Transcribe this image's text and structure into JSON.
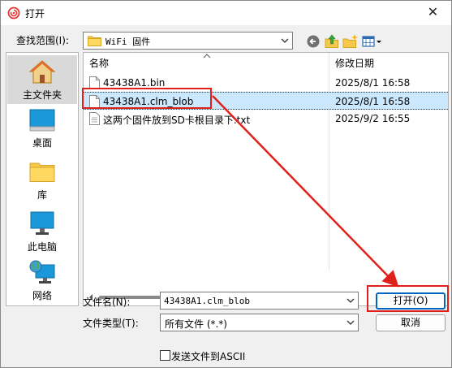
{
  "dialog": {
    "title": "打开",
    "close_glyph": "✕"
  },
  "toolbar": {
    "lookin_label": "查找范围(I):",
    "lookin_value": "WiFi 固件",
    "icons": [
      "back-icon",
      "up-folder-icon",
      "new-folder-icon",
      "view-menu-icon"
    ]
  },
  "places": [
    {
      "label": "主文件夹",
      "icon": "home-icon",
      "selected": true
    },
    {
      "label": "桌面",
      "icon": "desktop-icon"
    },
    {
      "label": "库",
      "icon": "library-icon"
    },
    {
      "label": "此电脑",
      "icon": "computer-icon"
    },
    {
      "label": "网络",
      "icon": "network-icon"
    }
  ],
  "filelist": {
    "columns": [
      "名称",
      "修改日期"
    ],
    "files": [
      {
        "name": "43438A1.bin",
        "modified": "2025/8/1 16:58"
      },
      {
        "name": "43438A1.clm_blob",
        "modified": "2025/8/1 16:58",
        "selected": true
      },
      {
        "name": "这两个固件放到SD卡根目录下.txt",
        "modified": "2025/9/2 16:55"
      }
    ]
  },
  "form": {
    "filename_label": "文件名(N):",
    "filename_value": "43438A1.clm_blob",
    "filetype_label": "文件类型(T):",
    "filetype_value": "所有文件 (*.*)",
    "open_label": "打开(O)",
    "cancel_label": "取消",
    "ascii_label": "发送文件到ASCII",
    "ascii_checked": false
  },
  "colors": {
    "accent": "#0067c0",
    "selection": "#cce8ff",
    "annotation": "#e0211b"
  }
}
